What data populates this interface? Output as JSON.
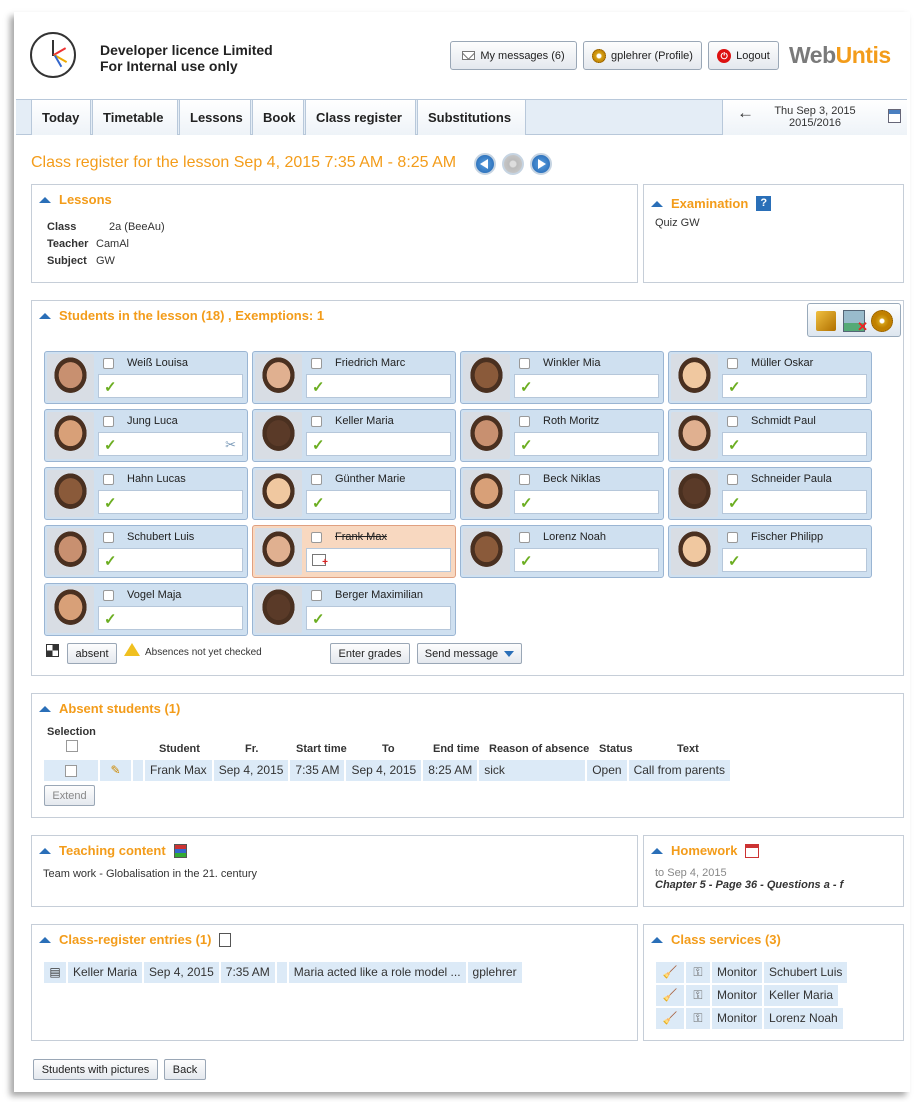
{
  "header": {
    "licence_line1": "Developer licence Limited",
    "licence_line2": "For Internal use only",
    "messages_label": "My messages (6)",
    "profile_label": "gplehrer (Profile)",
    "logout_label": "Logout",
    "logo_web": "Web",
    "logo_untis": "Untis",
    "logo_colors": {
      "web": "#7a7a7a",
      "untis": "#f39c1a"
    }
  },
  "nav": {
    "items": [
      "Today",
      "Timetable",
      "Lessons",
      "Book",
      "Class register",
      "Substitutions"
    ],
    "date_line1": "Thu Sep 3, 2015",
    "date_line2": "2015/2016"
  },
  "page_title": "Class register for the lesson Sep 4, 2015 7:35 AM - 8:25 AM",
  "lessons": {
    "title": "Lessons",
    "class_label": "Class",
    "class_value": "2a (BeeAu)",
    "teacher_label": "Teacher",
    "teacher_value": "CamAl",
    "subject_label": "Subject",
    "subject_value": "GW"
  },
  "examination": {
    "title": "Examination",
    "value": "Quiz GW"
  },
  "students": {
    "title": "Students in the lesson (18) , Exemptions: 1",
    "absent_button": "absent",
    "warning_text": "Absences not yet checked",
    "enter_grades": "Enter grades",
    "send_message": "Send message",
    "list": [
      {
        "name": "Weiß Louisa"
      },
      {
        "name": "Friedrich Marc"
      },
      {
        "name": "Winkler Mia"
      },
      {
        "name": "Müller Oskar"
      },
      {
        "name": "Jung Luca"
      },
      {
        "name": "Keller Maria"
      },
      {
        "name": "Roth Moritz"
      },
      {
        "name": "Schmidt Paul"
      },
      {
        "name": "Hahn Lucas"
      },
      {
        "name": "Günther Marie"
      },
      {
        "name": "Beck Niklas"
      },
      {
        "name": "Schneider Paula"
      },
      {
        "name": "Schubert Luis"
      },
      {
        "name": "Frank Max"
      },
      {
        "name": "Lorenz Noah"
      },
      {
        "name": "Fischer Philipp"
      },
      {
        "name": "Vogel Maja"
      },
      {
        "name": "Berger Maximilian"
      }
    ]
  },
  "absent": {
    "title": "Absent students (1)",
    "selection_label": "Selection",
    "headers": [
      "Student",
      "Fr.",
      "Start time",
      "To",
      "End time",
      "Reason of absence",
      "Status",
      "Text"
    ],
    "row": [
      "Frank Max",
      "Sep 4, 2015",
      "7:35 AM",
      "Sep 4, 2015",
      "8:25 AM",
      "sick",
      "Open",
      "Call from parents"
    ],
    "extend": "Extend"
  },
  "teaching": {
    "title": "Teaching content",
    "text": "Team work - Globalisation in the 21. century"
  },
  "homework": {
    "title": "Homework",
    "due": "to Sep 4, 2015",
    "text": "Chapter 5 - Page 36 - Questions a - f"
  },
  "entries": {
    "title": "Class-register entries (1)",
    "row": [
      "Keller Maria",
      "Sep 4, 2015",
      "7:35 AM",
      "Maria acted like a role model ...",
      "gplehrer"
    ]
  },
  "services": {
    "title": "Class services (3)",
    "rows": [
      {
        "role": "Monitor",
        "name": "Schubert Luis"
      },
      {
        "role": "Monitor",
        "name": "Keller Maria"
      },
      {
        "role": "Monitor",
        "name": "Lorenz Noah"
      }
    ]
  },
  "footer": {
    "students_with_pictures": "Students with pictures",
    "back": "Back"
  }
}
